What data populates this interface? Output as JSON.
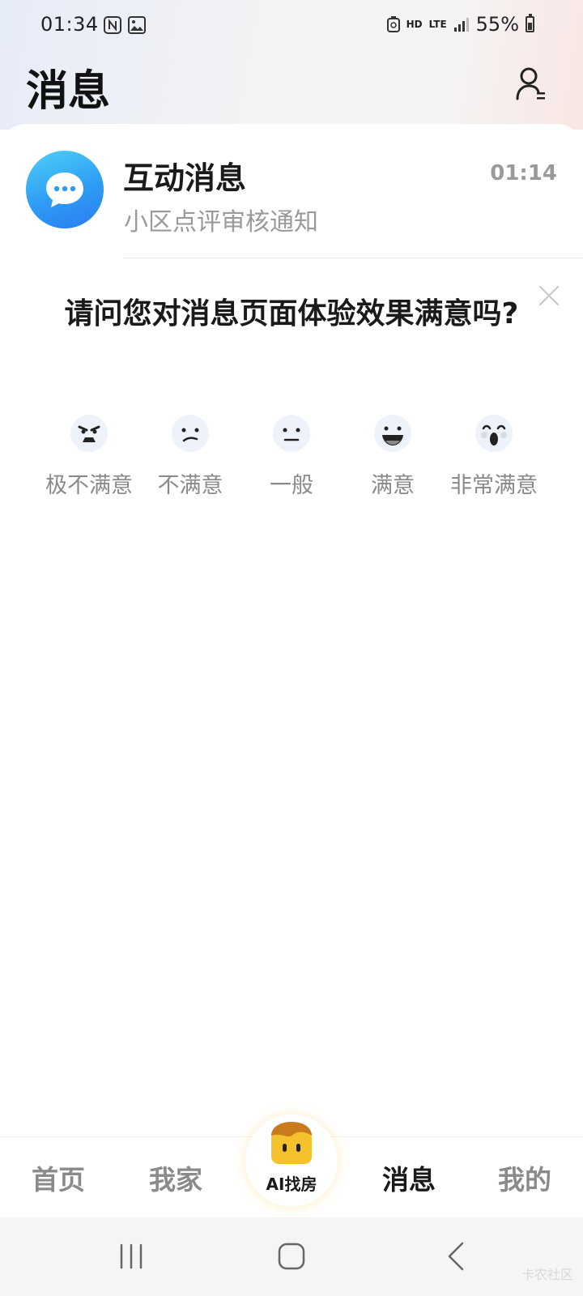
{
  "status_bar": {
    "time": "01:34",
    "hd_label": "HD",
    "lte_label": "LTE",
    "battery_text": "55%",
    "battery_level": 0.55,
    "icons": [
      "nfc-icon",
      "gallery-icon",
      "recycle-icon",
      "signal-icon",
      "battery-icon"
    ]
  },
  "header": {
    "title": "消息",
    "contact_icon": "contact-list-icon"
  },
  "message_list": [
    {
      "title": "互动消息",
      "subtitle": "小区点评审核通知",
      "time": "01:14",
      "icon": "chat-bubble-icon"
    }
  ],
  "survey": {
    "question": "请问您对消息页面体验效果满意吗?",
    "close_icon": "close-icon",
    "options": [
      {
        "label": "极不满意",
        "icon": "angry-face-icon"
      },
      {
        "label": "不满意",
        "icon": "unhappy-face-icon"
      },
      {
        "label": "一般",
        "icon": "neutral-face-icon"
      },
      {
        "label": "满意",
        "icon": "smile-face-icon"
      },
      {
        "label": "非常满意",
        "icon": "amazed-face-icon"
      }
    ]
  },
  "tab_bar": {
    "tabs": [
      {
        "label": "首页",
        "active": false
      },
      {
        "label": "我家",
        "active": false
      },
      {
        "label": "AI找房",
        "active": false
      },
      {
        "label": "消息",
        "active": true
      },
      {
        "label": "我的",
        "active": false
      }
    ]
  },
  "watermark": "卡农社区",
  "colors": {
    "accent_blue": "#2e9cf5",
    "muted_text": "#9a9a9a",
    "ai_yellow": "#f5c22e"
  }
}
